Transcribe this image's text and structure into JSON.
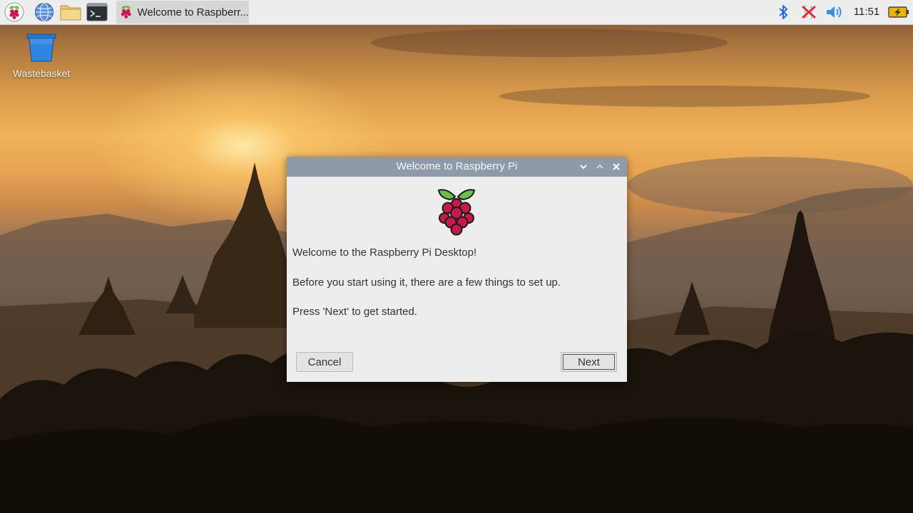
{
  "taskbar": {
    "launchers": [
      {
        "icon": "raspberry-menu-icon"
      },
      {
        "icon": "web-browser-icon"
      },
      {
        "icon": "file-manager-icon"
      },
      {
        "icon": "terminal-icon"
      }
    ],
    "task": {
      "icon": "raspberry-icon",
      "label": "Welcome to Raspberr..."
    },
    "tray": {
      "icons": [
        "bluetooth-icon",
        "network-disconnected-icon",
        "volume-icon",
        "battery-icon"
      ],
      "clock": "11:51"
    }
  },
  "desktop": {
    "icons": [
      {
        "icon": "wastebasket-icon",
        "label": "Wastebasket"
      }
    ]
  },
  "dialog": {
    "title": "Welcome to Raspberry Pi",
    "controls": [
      "minimize-icon",
      "maximize-icon",
      "close-icon"
    ],
    "messages": [
      "Welcome to the Raspberry Pi Desktop!",
      "Before you start using it, there are a few things to set up.",
      "Press 'Next' to get started."
    ],
    "buttons": {
      "cancel": "Cancel",
      "next": "Next"
    }
  },
  "colors": {
    "taskbar_bg": "#ededed",
    "dialog_bg": "#ededed",
    "titlebar_bg": "#8e9aa8",
    "raspberry_red": "#c51a4a",
    "leaf_green": "#6cc04a"
  }
}
